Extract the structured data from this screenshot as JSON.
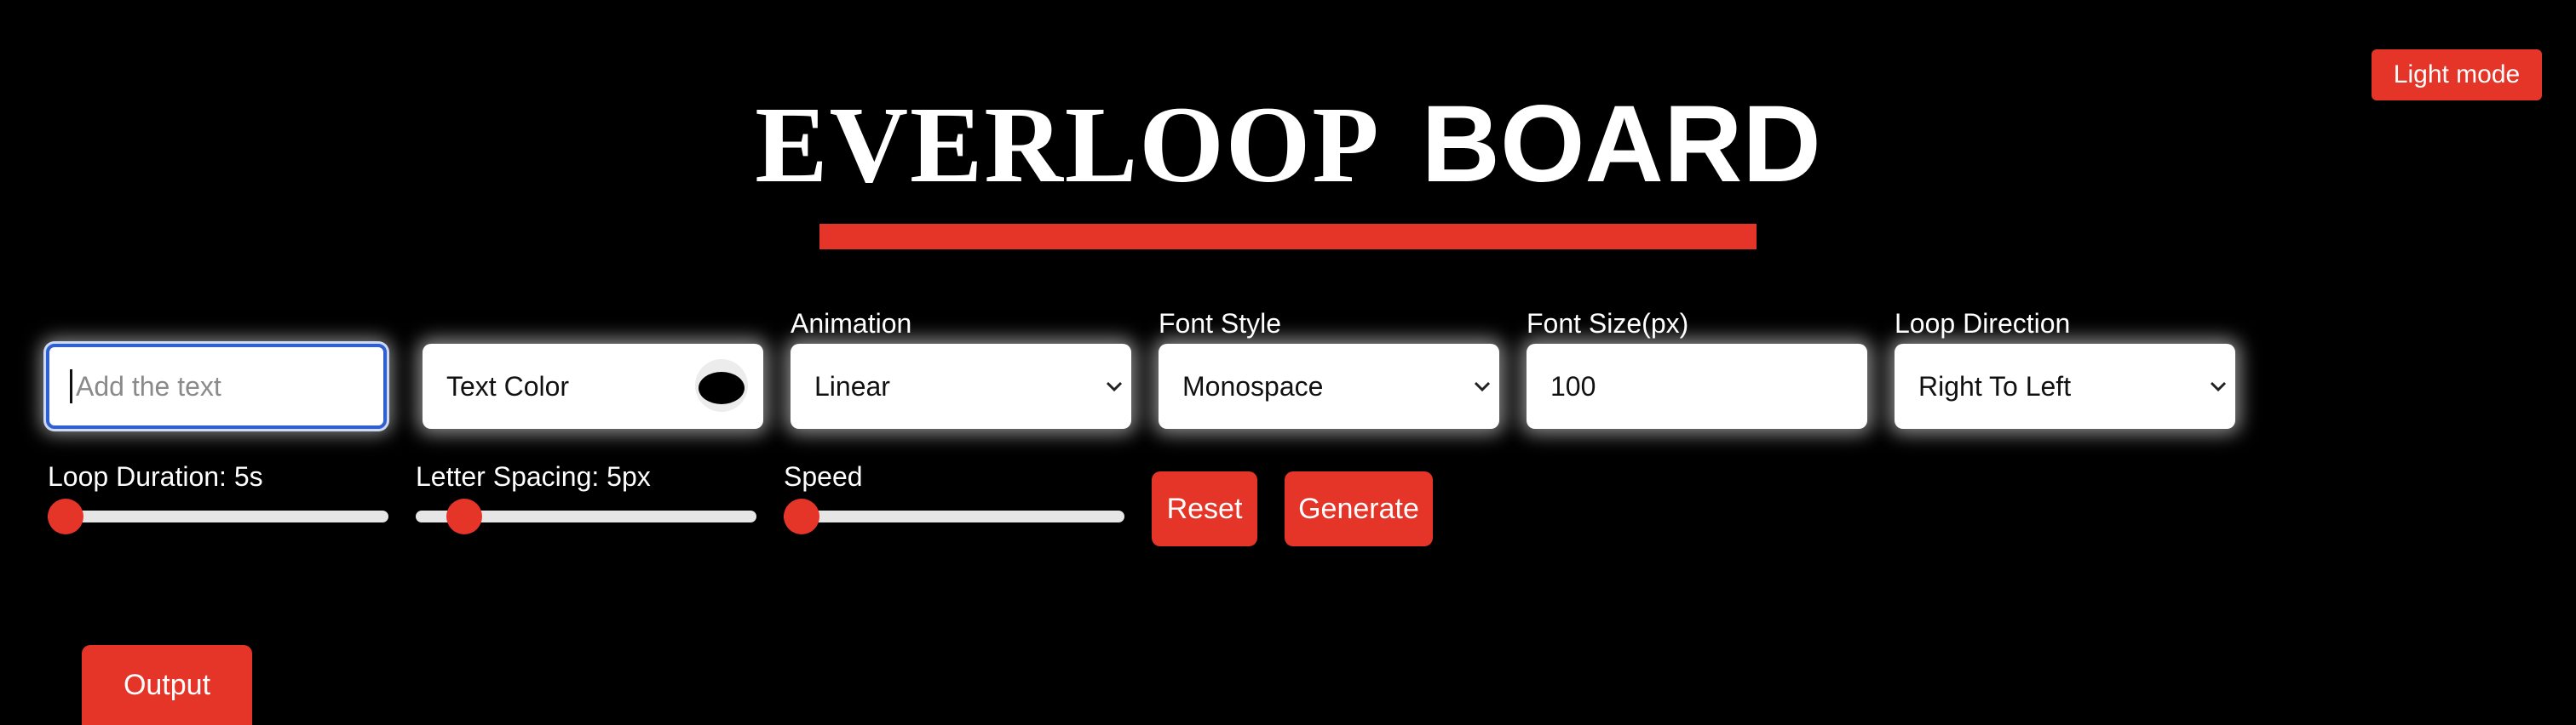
{
  "header": {
    "mode_toggle_label": "Light mode",
    "title_part1": "EVERLOOP",
    "title_part2": "BOARD"
  },
  "controls": {
    "text_input": {
      "value": "",
      "placeholder": "Add the text"
    },
    "text_color": {
      "label": "Text Color",
      "value": "#000000"
    },
    "animation": {
      "label": "Animation",
      "value": "Linear"
    },
    "font_style": {
      "label": "Font Style",
      "value": "Monospace"
    },
    "font_size": {
      "label": "Font Size(px)",
      "value": "100"
    },
    "loop_direction": {
      "label": "Loop Direction",
      "value": "Right To Left"
    }
  },
  "sliders": {
    "loop_duration": {
      "label": "Loop Duration: 5s",
      "level": 0.0
    },
    "letter_spacing": {
      "label": "Letter Spacing: 5px",
      "level": 0.1
    },
    "speed": {
      "label": "Speed",
      "level": 0.0
    }
  },
  "buttons": {
    "reset": "Reset",
    "generate": "Generate",
    "output": "Output"
  },
  "colors": {
    "background": "#000000",
    "accent": "#e53528",
    "focus": "#2f5fd0"
  },
  "icons": {
    "dropdown": "chevron-down-icon"
  }
}
